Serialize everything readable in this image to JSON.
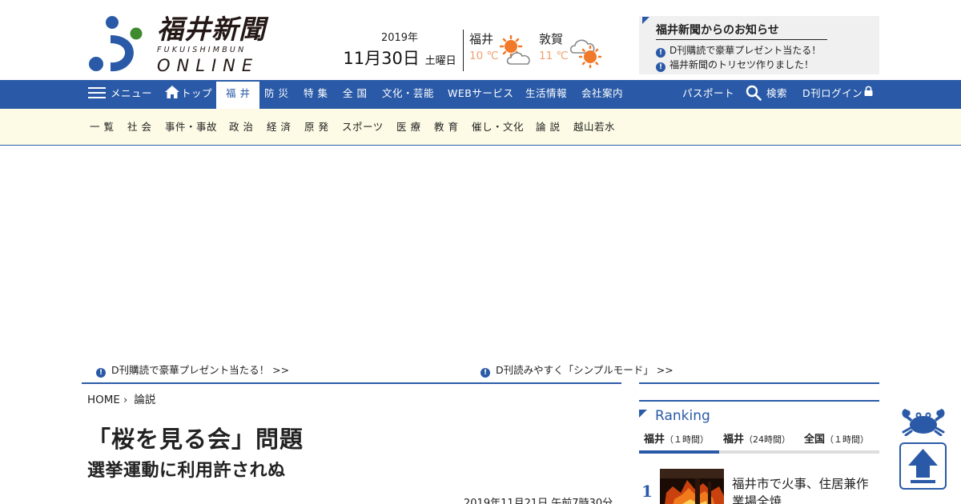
{
  "brand": {
    "name_jp": "福井新聞",
    "name_romaji": "FUKUISHIMBUN",
    "name_sub": "ONLINE",
    "color_primary": "#2a5aa7",
    "color_mark_green": "#3d8a2f"
  },
  "date": {
    "year": "2019年",
    "month_day": "11月30日",
    "weekday": "土曜日"
  },
  "weather": [
    {
      "city": "福井",
      "temp": "10 ℃",
      "icon": "sun-cloud-icon"
    },
    {
      "city": "敦賀",
      "temp": "11 ℃",
      "icon": "cloud-sun-icon"
    }
  ],
  "notice": {
    "title": "福井新聞からのお知らせ",
    "items": [
      "D刊購読で豪華プレゼント当たる！",
      "福井新聞のトリセツ作りました！"
    ]
  },
  "nav": {
    "menu": "メニュー",
    "top": "トップ",
    "items": [
      "福 井",
      "防 災",
      "特 集",
      "全 国",
      "文化・芸能",
      "WEBサービス",
      "生活情報",
      "会社案内"
    ],
    "active": "福 井",
    "passport": "パスポート",
    "search": "検索",
    "login": "D刊ログイン"
  },
  "subnav": [
    "一 覧",
    "社 会",
    "事件・事故",
    "政 治",
    "経 済",
    "原 発",
    "スポーツ",
    "医 療",
    "教 育",
    "催し・文化",
    "論 説",
    "越山若水"
  ],
  "promos": [
    "D刊購読で豪華プレゼント当たる！ >>",
    "D刊読みやすく「シンプルモード」 >>"
  ],
  "breadcrumb": {
    "home": "HOME",
    "section": "論説"
  },
  "article": {
    "headline": "「桜を見る会」問題",
    "subhead": "選挙運動に利用許されぬ",
    "published": "2019年11月21日 午前7時30分"
  },
  "ranking": {
    "title": "Ranking",
    "tabs": [
      {
        "name": "福井",
        "period": "（１時間）"
      },
      {
        "name": "福井",
        "period": "（24時間）"
      },
      {
        "name": "全国",
        "period": "（１時間）"
      }
    ],
    "active_tab": 0,
    "items": [
      {
        "rank": "1",
        "headline": "福井市で火事、住居兼作業場全焼"
      }
    ]
  }
}
